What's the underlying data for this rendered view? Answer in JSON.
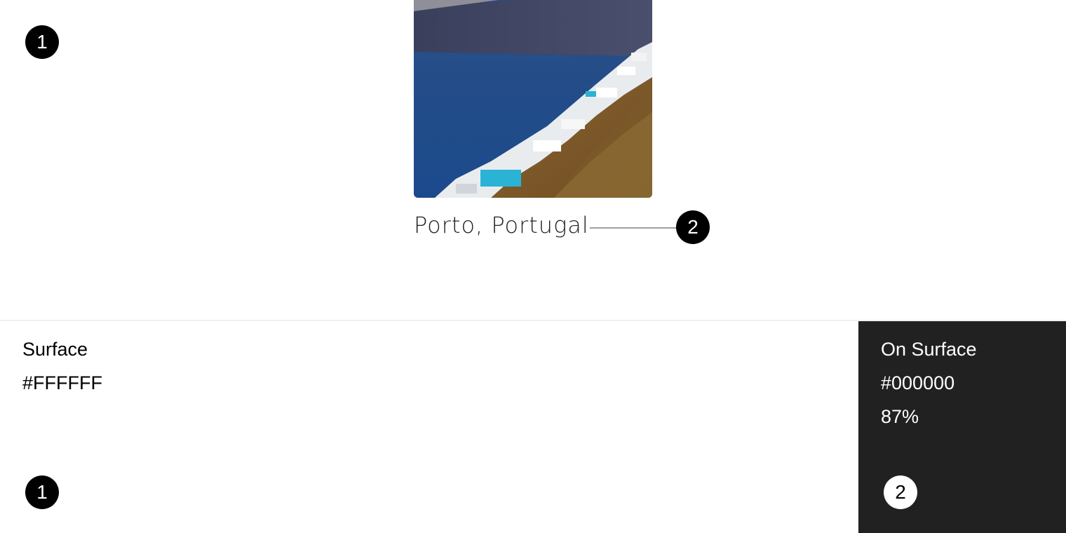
{
  "preview": {
    "marker_1": "1",
    "marker_2": "2",
    "caption": "Porto, Portugal"
  },
  "swatches": [
    {
      "name": "Surface",
      "hex": "#FFFFFF",
      "marker": "1",
      "color": "#FFFFFF"
    },
    {
      "name": "On Surface",
      "hex": "#000000",
      "opacity": "87%",
      "marker": "2",
      "color": "#212121"
    }
  ]
}
